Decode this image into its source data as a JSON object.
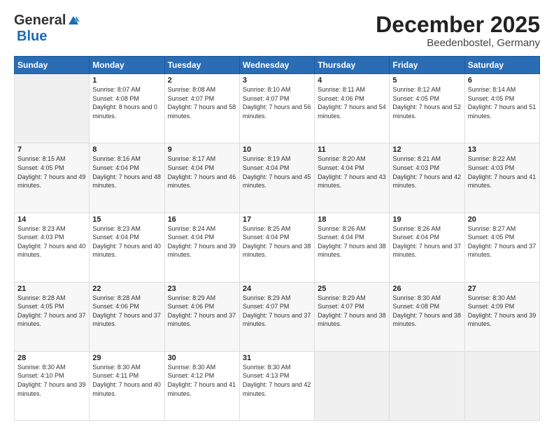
{
  "logo": {
    "general": "General",
    "blue": "Blue"
  },
  "header": {
    "month": "December 2025",
    "location": "Beedenbostel, Germany"
  },
  "days_of_week": [
    "Sunday",
    "Monday",
    "Tuesday",
    "Wednesday",
    "Thursday",
    "Friday",
    "Saturday"
  ],
  "weeks": [
    [
      {
        "day": "",
        "empty": true
      },
      {
        "day": "1",
        "sunrise": "8:07 AM",
        "sunset": "4:08 PM",
        "daylight": "8 hours and 0 minutes."
      },
      {
        "day": "2",
        "sunrise": "8:08 AM",
        "sunset": "4:07 PM",
        "daylight": "7 hours and 58 minutes."
      },
      {
        "day": "3",
        "sunrise": "8:10 AM",
        "sunset": "4:07 PM",
        "daylight": "7 hours and 56 minutes."
      },
      {
        "day": "4",
        "sunrise": "8:11 AM",
        "sunset": "4:06 PM",
        "daylight": "7 hours and 54 minutes."
      },
      {
        "day": "5",
        "sunrise": "8:12 AM",
        "sunset": "4:05 PM",
        "daylight": "7 hours and 52 minutes."
      },
      {
        "day": "6",
        "sunrise": "8:14 AM",
        "sunset": "4:05 PM",
        "daylight": "7 hours and 51 minutes."
      }
    ],
    [
      {
        "day": "7",
        "sunrise": "8:15 AM",
        "sunset": "4:05 PM",
        "daylight": "7 hours and 49 minutes."
      },
      {
        "day": "8",
        "sunrise": "8:16 AM",
        "sunset": "4:04 PM",
        "daylight": "7 hours and 48 minutes."
      },
      {
        "day": "9",
        "sunrise": "8:17 AM",
        "sunset": "4:04 PM",
        "daylight": "7 hours and 46 minutes."
      },
      {
        "day": "10",
        "sunrise": "8:19 AM",
        "sunset": "4:04 PM",
        "daylight": "7 hours and 45 minutes."
      },
      {
        "day": "11",
        "sunrise": "8:20 AM",
        "sunset": "4:04 PM",
        "daylight": "7 hours and 43 minutes."
      },
      {
        "day": "12",
        "sunrise": "8:21 AM",
        "sunset": "4:03 PM",
        "daylight": "7 hours and 42 minutes."
      },
      {
        "day": "13",
        "sunrise": "8:22 AM",
        "sunset": "4:03 PM",
        "daylight": "7 hours and 41 minutes."
      }
    ],
    [
      {
        "day": "14",
        "sunrise": "8:23 AM",
        "sunset": "4:03 PM",
        "daylight": "7 hours and 40 minutes."
      },
      {
        "day": "15",
        "sunrise": "8:23 AM",
        "sunset": "4:04 PM",
        "daylight": "7 hours and 40 minutes."
      },
      {
        "day": "16",
        "sunrise": "8:24 AM",
        "sunset": "4:04 PM",
        "daylight": "7 hours and 39 minutes."
      },
      {
        "day": "17",
        "sunrise": "8:25 AM",
        "sunset": "4:04 PM",
        "daylight": "7 hours and 38 minutes."
      },
      {
        "day": "18",
        "sunrise": "8:26 AM",
        "sunset": "4:04 PM",
        "daylight": "7 hours and 38 minutes."
      },
      {
        "day": "19",
        "sunrise": "8:26 AM",
        "sunset": "4:04 PM",
        "daylight": "7 hours and 37 minutes."
      },
      {
        "day": "20",
        "sunrise": "8:27 AM",
        "sunset": "4:05 PM",
        "daylight": "7 hours and 37 minutes."
      }
    ],
    [
      {
        "day": "21",
        "sunrise": "8:28 AM",
        "sunset": "4:05 PM",
        "daylight": "7 hours and 37 minutes."
      },
      {
        "day": "22",
        "sunrise": "8:28 AM",
        "sunset": "4:06 PM",
        "daylight": "7 hours and 37 minutes."
      },
      {
        "day": "23",
        "sunrise": "8:29 AM",
        "sunset": "4:06 PM",
        "daylight": "7 hours and 37 minutes."
      },
      {
        "day": "24",
        "sunrise": "8:29 AM",
        "sunset": "4:07 PM",
        "daylight": "7 hours and 37 minutes."
      },
      {
        "day": "25",
        "sunrise": "8:29 AM",
        "sunset": "4:07 PM",
        "daylight": "7 hours and 38 minutes."
      },
      {
        "day": "26",
        "sunrise": "8:30 AM",
        "sunset": "4:08 PM",
        "daylight": "7 hours and 38 minutes."
      },
      {
        "day": "27",
        "sunrise": "8:30 AM",
        "sunset": "4:09 PM",
        "daylight": "7 hours and 39 minutes."
      }
    ],
    [
      {
        "day": "28",
        "sunrise": "8:30 AM",
        "sunset": "4:10 PM",
        "daylight": "7 hours and 39 minutes."
      },
      {
        "day": "29",
        "sunrise": "8:30 AM",
        "sunset": "4:11 PM",
        "daylight": "7 hours and 40 minutes."
      },
      {
        "day": "30",
        "sunrise": "8:30 AM",
        "sunset": "4:12 PM",
        "daylight": "7 hours and 41 minutes."
      },
      {
        "day": "31",
        "sunrise": "8:30 AM",
        "sunset": "4:13 PM",
        "daylight": "7 hours and 42 minutes."
      },
      {
        "day": "",
        "empty": true
      },
      {
        "day": "",
        "empty": true
      },
      {
        "day": "",
        "empty": true
      }
    ]
  ],
  "labels": {
    "sunrise": "Sunrise: ",
    "sunset": "Sunset: ",
    "daylight": "Daylight: "
  }
}
